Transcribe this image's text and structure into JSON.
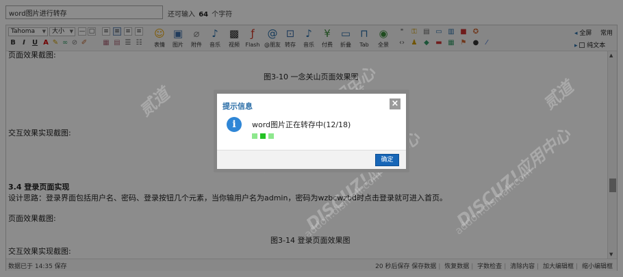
{
  "title_input": {
    "value": "word图片进行转存"
  },
  "counter": {
    "prefix": "还可输入",
    "count": "64",
    "suffix": "个字符"
  },
  "toolbar": {
    "font_family": "Tahoma",
    "font_size": "大小",
    "buttons": [
      {
        "label": "表情",
        "icon": "smiley-icon"
      },
      {
        "label": "图片",
        "icon": "image-icon"
      },
      {
        "label": "附件",
        "icon": "paperclip-icon"
      },
      {
        "label": "音乐",
        "icon": "music-note-icon"
      },
      {
        "label": "视频",
        "icon": "film-icon"
      },
      {
        "label": "Flash",
        "icon": "flash-icon"
      },
      {
        "label": "@朋友",
        "icon": "at-icon"
      },
      {
        "label": "转存",
        "icon": "save-image-icon"
      },
      {
        "label": "音乐",
        "icon": "music-note-icon"
      },
      {
        "label": "付费",
        "icon": "yen-icon"
      },
      {
        "label": "折叠",
        "icon": "collapse-icon"
      },
      {
        "label": "Tab",
        "icon": "tab-icon"
      },
      {
        "label": "全景",
        "icon": "eye-icon"
      }
    ],
    "right": {
      "fullscreen": "全屏",
      "common": "常用",
      "plain_text": "纯文本"
    }
  },
  "content": {
    "line1": "页面效果截图:",
    "caption1": "图3-10 一念关山页面效果图",
    "line2": "交互效果实现截图:",
    "heading": "3.4 登录页面实现",
    "design": "设计思路：登录界面包括用户名、密码、登录按钮几个元素，当你输用户名为admin，密码为wzbcwzbd时点击登录就可进入首页。",
    "line3": "页面效果截图:",
    "caption2": "图3-14 登录页面效果图",
    "line4": "交互效果实现截图:"
  },
  "status": {
    "left": "数据已于 14:35 保存",
    "right": [
      "20 秒后保存 保存数据",
      "恢复数据",
      "字数检查",
      "清除内容",
      "加大编辑框",
      "缩小编辑框"
    ]
  },
  "watermark": {
    "brand": "DISCUZ!应用中心",
    "domain": "addon.dismall.com",
    "right": "贰道"
  },
  "dialog": {
    "title": "提示信息",
    "message": "word图片正在转存中(12/18)",
    "ok_label": "确定",
    "colors": {
      "dot1": "#8ee88e",
      "dot2": "#24c224",
      "dot3": "#8ee88e",
      "accent": "#1766b7"
    }
  }
}
